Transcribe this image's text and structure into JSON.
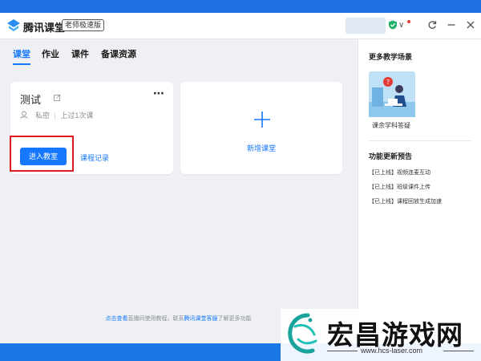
{
  "app": {
    "title": "腾讯课堂",
    "edition_badge": "老师极速版"
  },
  "tabs": [
    {
      "label": "课堂",
      "active": true
    },
    {
      "label": "作业",
      "active": false
    },
    {
      "label": "课件",
      "active": false
    },
    {
      "label": "备课资源",
      "active": false
    }
  ],
  "course_card": {
    "title": "测试",
    "visibility": "私密",
    "separator": "|",
    "last_class": "上过1次课",
    "enter_button": "进入教室",
    "record_link": "课程记录",
    "more_icon": "⋯"
  },
  "new_class_card": {
    "label": "新增课堂"
  },
  "help": {
    "part1": "点击查看",
    "part2": "直播间使用教程，联系",
    "part3": "腾讯课堂客服",
    "part4": "了解更多功能"
  },
  "sidebar": {
    "scenes_heading": "更多教学场景",
    "scene_label": "课余学科答疑",
    "updates_heading": "功能更新预告",
    "updates": [
      "【已上线】视频连麦互动",
      "【已上线】班级课件上传",
      "【已上线】课程回放生成加速"
    ]
  },
  "watermark": {
    "title": "宏昌游戏网",
    "url": "www.hcs-laser.com"
  },
  "icons": {
    "logo": "tencent-classroom-logo-icon",
    "shield": "shield-check-icon",
    "refresh": "refresh-icon",
    "minimize": "minimize-icon",
    "close": "close-icon"
  },
  "colors": {
    "accent": "#1677ff",
    "highlight": "#e0191a",
    "panel_bg": "#eef0f4"
  }
}
